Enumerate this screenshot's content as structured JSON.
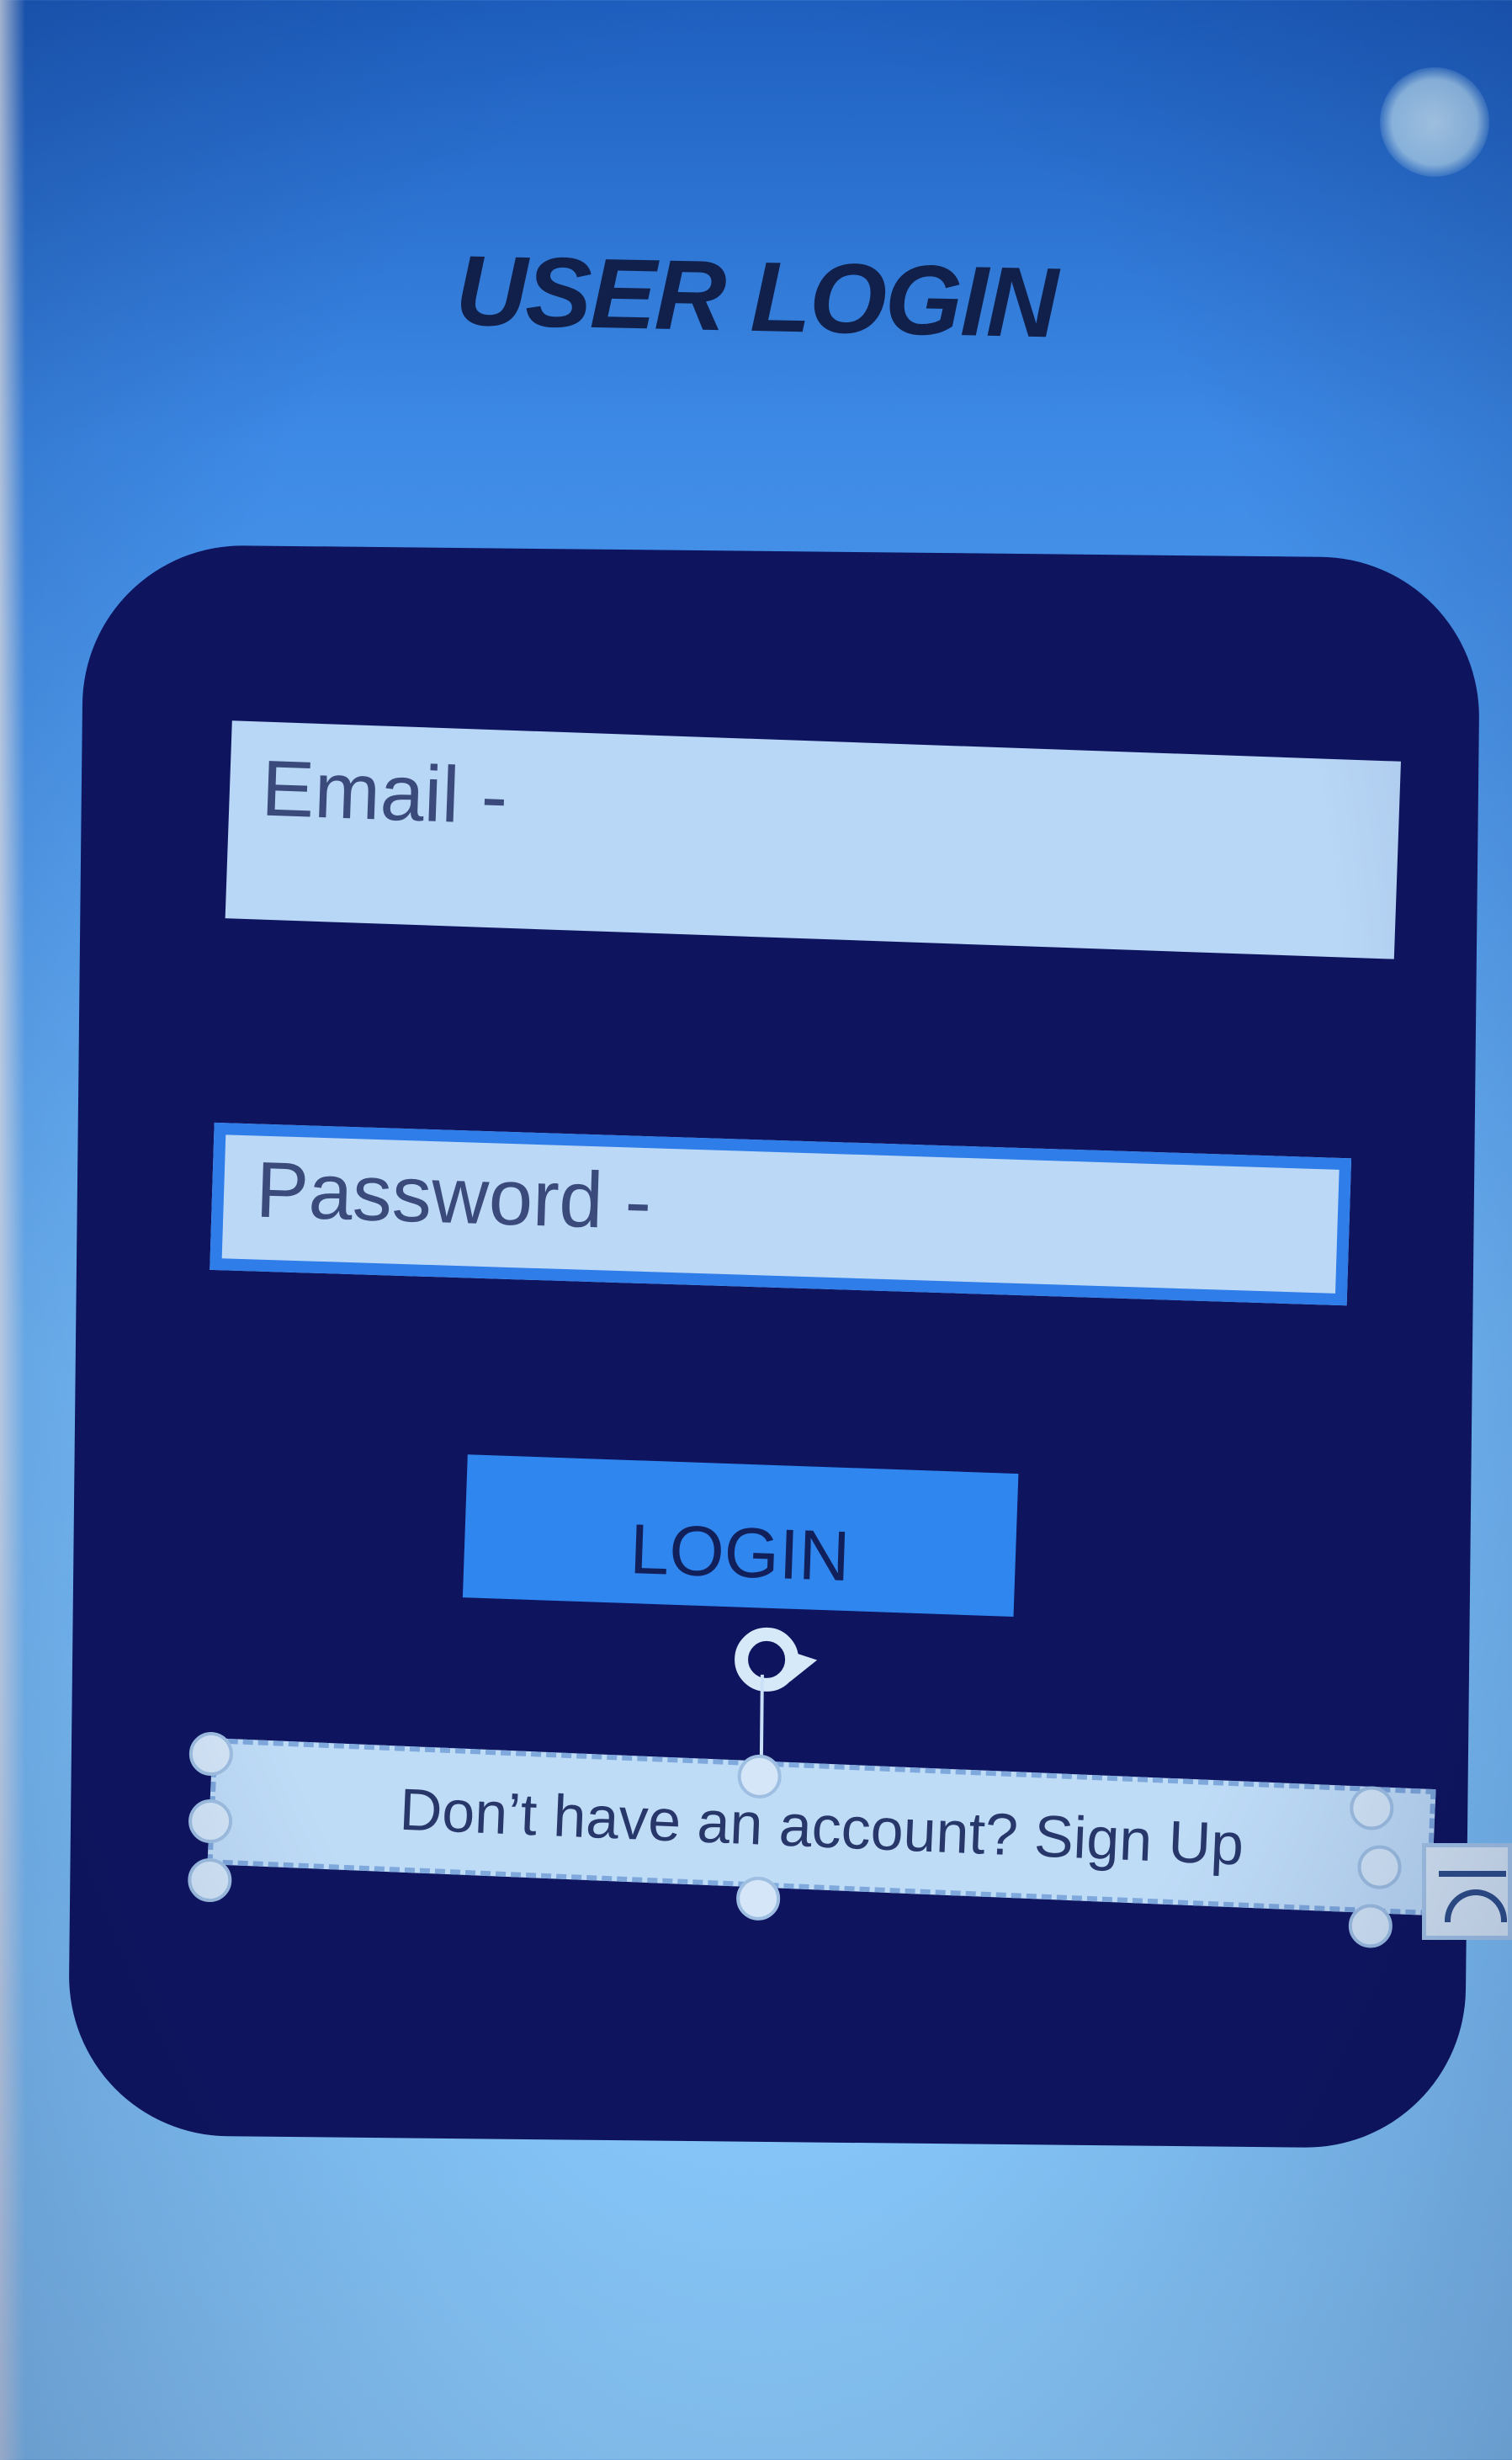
{
  "screen": {
    "title": "USER LOGIN"
  },
  "form": {
    "email_label": "Email -",
    "password_label": "Password -",
    "login_label": "LOGIN",
    "signup_text": "Don’t have an account? Sign Up"
  },
  "icons": {
    "rotate_handle": "rotate-icon",
    "side_widget": "layout-options-icon"
  },
  "colors": {
    "card": "#0f145e",
    "field": "#b8d6f6",
    "button": "#2f86ee",
    "title": "#10204a"
  }
}
